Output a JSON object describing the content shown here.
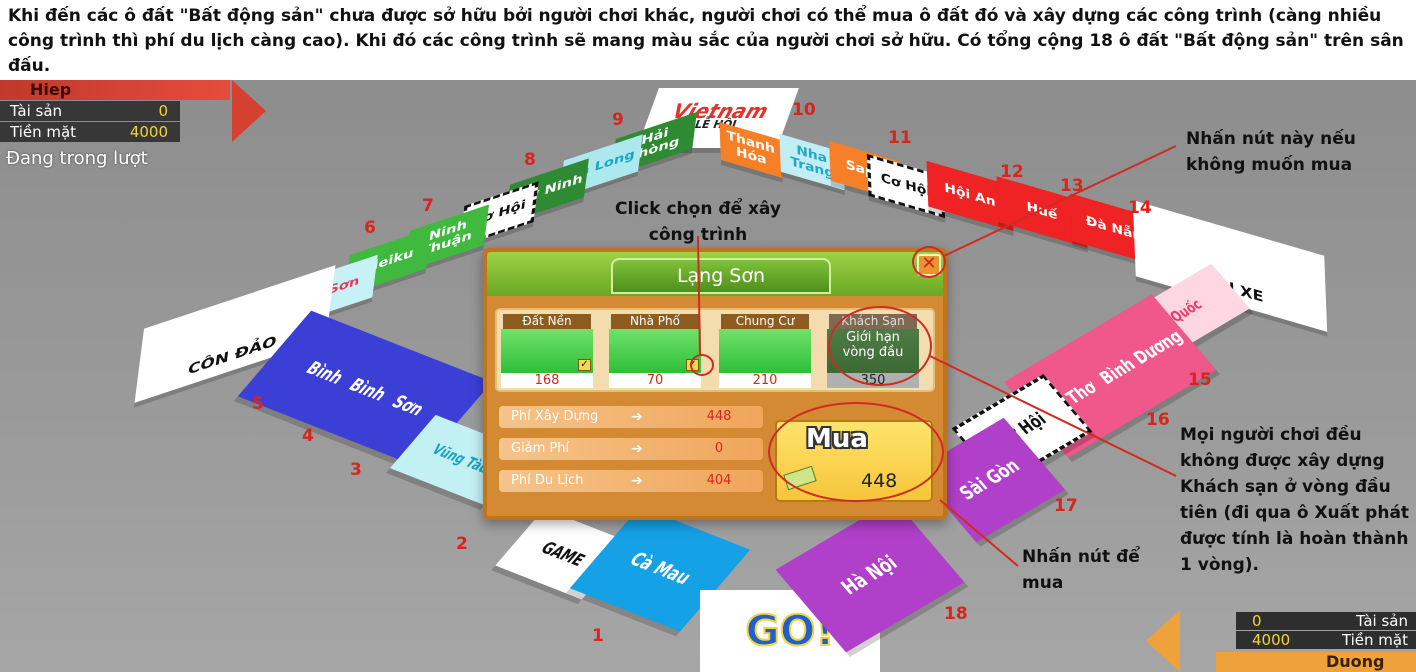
{
  "intro_text": "Khi đến các ô đất \"Bất động sản\" chưa được sở hữu bởi người chơi khác, người chơi có thể mua ô đất đó và xây dựng các công trình (càng nhiều công trình thì phí du lịch càng cao). Khi đó các công trình sẽ mang màu sắc của người chơi sở hữu. Có tổng cộng 18 ô đất \"Bất động sản\" trên sân đấu.",
  "player_top": {
    "name": "Hiep",
    "assets_label": "Tài sản",
    "assets_value": "0",
    "cash_label": "Tiền mặt",
    "cash_value": "4000",
    "status": "Đang trong lượt"
  },
  "player_bottom": {
    "name": "Duong",
    "assets_label": "Tài sản",
    "assets_value": "0",
    "cash_label": "Tiền mặt",
    "cash_value": "4000"
  },
  "board": {
    "tiles": {
      "vietnam": "Vietnam",
      "le_hoi": "LỄ HỘI",
      "hai_phong": "Hải Phòng",
      "ha_long": "Hạ Long",
      "tay_ninh": "Tây Ninh",
      "co_hoi_1": "Cơ Hội",
      "ninh_thuan": "Ninh Thuận",
      "pleiku": "Pleiku",
      "do_son": "Đồ Sơn",
      "con_dao": "CÔN ĐẢO",
      "binh": "Bình",
      "binh2": "Bình",
      "son": "Sơn",
      "vung_tau": "Vũng Tàu",
      "game": "GAME",
      "ca_mau": "Cà Mau",
      "thanh_hoa": "Thanh Hóa",
      "nha_trang": "Nha Trang",
      "sapa": "Sapa",
      "co_hoi_2": "Cơ Hội",
      "hoi_an": "Hội An",
      "hue": "Huế",
      "da_nang": "Đà Nẵng",
      "ben_xe": "BẾN XE",
      "phu_quoc": "Phú Quốc",
      "binh_duong": "Bình Dương",
      "can_tho": "Cần Thơ",
      "co_hoi_3": "Cơ Hội",
      "sai_gon": "Sài Gòn",
      "ha_noi": "Hà Nội",
      "go": "GO!"
    },
    "numbers": [
      "1",
      "2",
      "3",
      "4",
      "5",
      "6",
      "7",
      "8",
      "9",
      "10",
      "11",
      "12",
      "13",
      "14",
      "15",
      "16",
      "17",
      "18"
    ]
  },
  "dialog": {
    "title": "Lạng Sơn",
    "close_symbol": "✕",
    "options": [
      {
        "label": "Đất Nền",
        "price": "168",
        "checked": true
      },
      {
        "label": "Nhà Phố",
        "price": "70",
        "checked": true
      },
      {
        "label": "Chung Cư",
        "price": "210",
        "checked": false
      },
      {
        "label": "Khách Sạn",
        "price": "350",
        "limit_text": "Giới hạn vòng đầu"
      }
    ],
    "fees": [
      {
        "label": "Phí Xây Dựng",
        "value": "448"
      },
      {
        "label": "Giảm Phí",
        "value": "0"
      },
      {
        "label": "Phí Du Lịch",
        "value": "404"
      }
    ],
    "buy_label": "Mua",
    "buy_amount": "448"
  },
  "annotations": {
    "click_build": "Click chọn để xây công trình",
    "close_hint": "Nhấn nút này nếu không muốn mua",
    "hotel_rule": "Mọi người chơi đều không được xây dựng Khách sạn ở vòng đầu tiên (đi qua ô Xuất phát được tính là hoàn thành 1 vòng).",
    "buy_hint": "Nhấn nút để mua"
  },
  "colors": {
    "annotation_red": "#d02a22",
    "player_top": "#e74c3c",
    "player_bottom": "#f0a23a"
  }
}
